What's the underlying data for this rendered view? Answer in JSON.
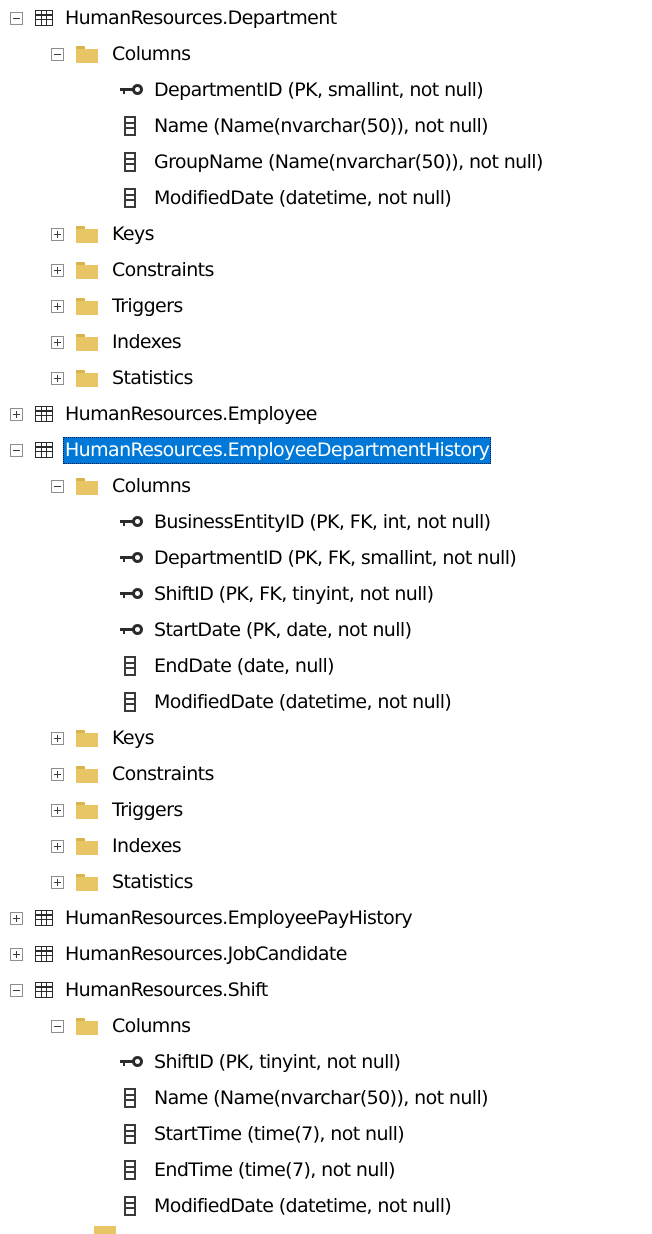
{
  "tree": [
    {
      "level": 0,
      "kind": "table",
      "label": "HumanResources.Department",
      "expander": "expanded",
      "icon": "table-icon"
    },
    {
      "level": 1,
      "kind": "folder",
      "label": "Columns",
      "expander": "expanded",
      "icon": "folder-icon"
    },
    {
      "level": 2,
      "kind": "key",
      "label": "DepartmentID (PK, smallint, not null)",
      "icon": "key-icon"
    },
    {
      "level": 2,
      "kind": "column",
      "label": "Name (Name(nvarchar(50)), not null)",
      "icon": "column-icon"
    },
    {
      "level": 2,
      "kind": "column",
      "label": "GroupName (Name(nvarchar(50)), not null)",
      "icon": "column-icon"
    },
    {
      "level": 2,
      "kind": "column",
      "label": "ModifiedDate (datetime, not null)",
      "icon": "column-icon"
    },
    {
      "level": 1,
      "kind": "folder",
      "label": "Keys",
      "expander": "collapsed",
      "icon": "folder-icon"
    },
    {
      "level": 1,
      "kind": "folder",
      "label": "Constraints",
      "expander": "collapsed",
      "icon": "folder-icon"
    },
    {
      "level": 1,
      "kind": "folder",
      "label": "Triggers",
      "expander": "collapsed",
      "icon": "folder-icon"
    },
    {
      "level": 1,
      "kind": "folder",
      "label": "Indexes",
      "expander": "collapsed",
      "icon": "folder-icon"
    },
    {
      "level": 1,
      "kind": "folder",
      "label": "Statistics",
      "expander": "collapsed",
      "icon": "folder-icon"
    },
    {
      "level": 0,
      "kind": "table",
      "label": "HumanResources.Employee",
      "expander": "collapsed",
      "icon": "table-icon"
    },
    {
      "level": 0,
      "kind": "table",
      "label": "HumanResources.EmployeeDepartmentHistory",
      "expander": "expanded",
      "icon": "table-icon",
      "selected": true
    },
    {
      "level": 1,
      "kind": "folder",
      "label": "Columns",
      "expander": "expanded",
      "icon": "folder-icon"
    },
    {
      "level": 2,
      "kind": "key",
      "label": "BusinessEntityID (PK, FK, int, not null)",
      "icon": "key-icon"
    },
    {
      "level": 2,
      "kind": "key",
      "label": "DepartmentID (PK, FK, smallint, not null)",
      "icon": "key-icon"
    },
    {
      "level": 2,
      "kind": "key",
      "label": "ShiftID (PK, FK, tinyint, not null)",
      "icon": "key-icon"
    },
    {
      "level": 2,
      "kind": "key",
      "label": "StartDate (PK, date, not null)",
      "icon": "key-icon"
    },
    {
      "level": 2,
      "kind": "column",
      "label": "EndDate (date, null)",
      "icon": "column-icon"
    },
    {
      "level": 2,
      "kind": "column",
      "label": "ModifiedDate (datetime, not null)",
      "icon": "column-icon"
    },
    {
      "level": 1,
      "kind": "folder",
      "label": "Keys",
      "expander": "collapsed",
      "icon": "folder-icon"
    },
    {
      "level": 1,
      "kind": "folder",
      "label": "Constraints",
      "expander": "collapsed",
      "icon": "folder-icon"
    },
    {
      "level": 1,
      "kind": "folder",
      "label": "Triggers",
      "expander": "collapsed",
      "icon": "folder-icon"
    },
    {
      "level": 1,
      "kind": "folder",
      "label": "Indexes",
      "expander": "collapsed",
      "icon": "folder-icon"
    },
    {
      "level": 1,
      "kind": "folder",
      "label": "Statistics",
      "expander": "collapsed",
      "icon": "folder-icon"
    },
    {
      "level": 0,
      "kind": "table",
      "label": "HumanResources.EmployeePayHistory",
      "expander": "collapsed",
      "icon": "table-icon"
    },
    {
      "level": 0,
      "kind": "table",
      "label": "HumanResources.JobCandidate",
      "expander": "collapsed",
      "icon": "table-icon"
    },
    {
      "level": 0,
      "kind": "table",
      "label": "HumanResources.Shift",
      "expander": "expanded",
      "icon": "table-icon"
    },
    {
      "level": 1,
      "kind": "folder",
      "label": "Columns",
      "expander": "expanded",
      "icon": "folder-icon"
    },
    {
      "level": 2,
      "kind": "key",
      "label": "ShiftID (PK, tinyint, not null)",
      "icon": "key-icon"
    },
    {
      "level": 2,
      "kind": "column",
      "label": "Name (Name(nvarchar(50)), not null)",
      "icon": "column-icon"
    },
    {
      "level": 2,
      "kind": "column",
      "label": "StartTime (time(7), not null)",
      "icon": "column-icon"
    },
    {
      "level": 2,
      "kind": "column",
      "label": "EndTime (time(7), not null)",
      "icon": "column-icon"
    },
    {
      "level": 2,
      "kind": "column",
      "label": "ModifiedDate (datetime, not null)",
      "icon": "column-icon"
    }
  ],
  "colors": {
    "selection": "#0078d7",
    "folder": "#e8c565",
    "icon": "#2b2b2b"
  }
}
